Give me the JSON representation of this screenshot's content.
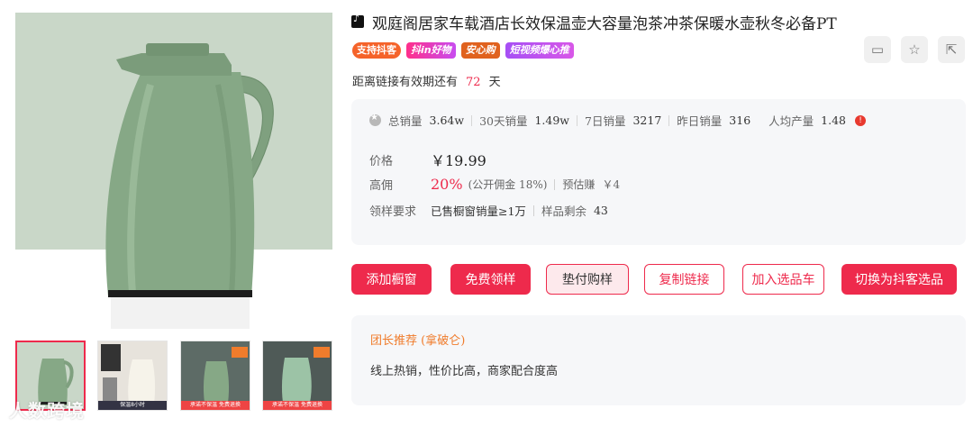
{
  "product": {
    "title": "观庭阁居家车载酒店长效保温壶大容量泡茶冲茶保暖水壶秋冬必备PT",
    "tags": [
      "支持抖客",
      "抖in好物",
      "安心购",
      "短视频爆心推"
    ],
    "expire_prefix": "距离链接有效期还有",
    "expire_days": "72",
    "expire_suffix": "天"
  },
  "actions": [
    {
      "icon": "card-icon"
    },
    {
      "icon": "star-icon"
    },
    {
      "icon": "share-icon"
    }
  ],
  "stats": {
    "total_label": "总销量",
    "total_value": "3.64w",
    "d30_label": "30天销量",
    "d30_value": "1.49w",
    "d7_label": "7日销量",
    "d7_value": "3217",
    "yesterday_label": "昨日销量",
    "yesterday_value": "316",
    "per_capita_label": "人均产量",
    "per_capita_value": "1.48"
  },
  "price": {
    "label": "价格",
    "value": "￥19.99"
  },
  "commission": {
    "label": "高佣",
    "rate": "20%",
    "public": "(公开佣金 18%)",
    "estimate_label": "预估赚",
    "estimate_value": "￥4"
  },
  "sample": {
    "label": "领样要求",
    "requirement": "已售橱窗销量≥1万",
    "remaining_label": "样品剩余",
    "remaining_value": "43"
  },
  "buttons": {
    "add_window": "添加橱窗",
    "free_sample": "免费领样",
    "prepay_sample": "垫付购样",
    "copy_link": "复制链接",
    "add_cart": "加入选品车",
    "switch_douke": "切换为抖客选品"
  },
  "recommend": {
    "title": "团长推荐 (拿破仑)",
    "text": "线上热销，性价比高，商家配合度高"
  },
  "thumbs": [
    {
      "caption": ""
    },
    {
      "caption": "保温8小时"
    },
    {
      "caption": "承诺不保温 免费退换"
    },
    {
      "caption": "承诺不保温 免费退换"
    }
  ],
  "watermark": "人数跨境",
  "colors": {
    "accent": "#ee2a4c",
    "kettle": "#7fa07f",
    "background": "#c9d7c8"
  }
}
